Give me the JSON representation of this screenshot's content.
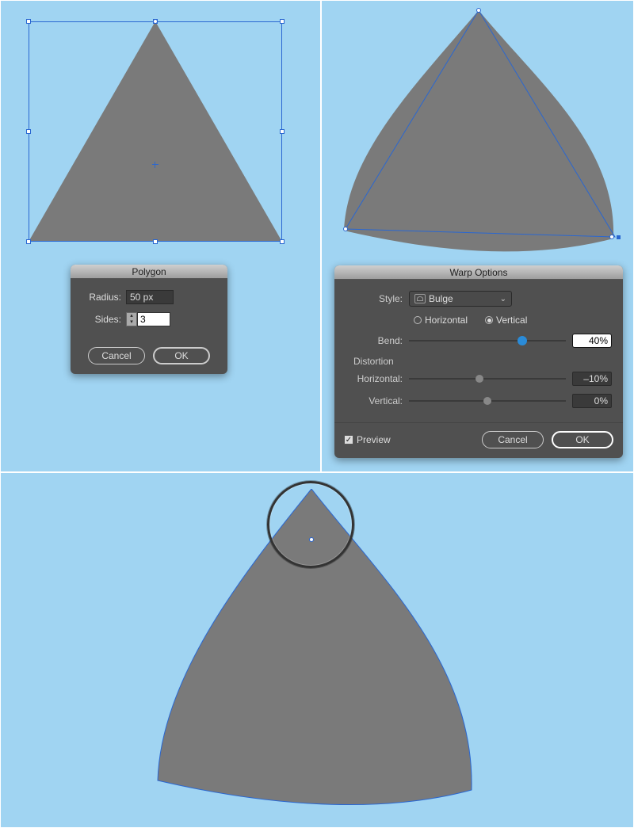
{
  "polygon_dialog": {
    "title": "Polygon",
    "radius_label": "Radius:",
    "radius_value": "50 px",
    "sides_label": "Sides:",
    "sides_value": "3",
    "cancel": "Cancel",
    "ok": "OK"
  },
  "warp_dialog": {
    "title": "Warp Options",
    "style_label": "Style:",
    "style_value": "Bulge",
    "orientation": {
      "horizontal": "Horizontal",
      "vertical": "Vertical",
      "selected": "vertical"
    },
    "bend_label": "Bend:",
    "bend_value": "40%",
    "distortion_label": "Distortion",
    "horizontal_label": "Horizontal:",
    "horizontal_value": "–10%",
    "vertical_label": "Vertical:",
    "vertical_value": "0%",
    "preview_label": "Preview",
    "preview_checked": true,
    "cancel": "Cancel",
    "ok": "OK"
  },
  "colors": {
    "canvas": "#a0d4f2",
    "shape": "#7a7a7a",
    "outline": "#2a67d1"
  }
}
